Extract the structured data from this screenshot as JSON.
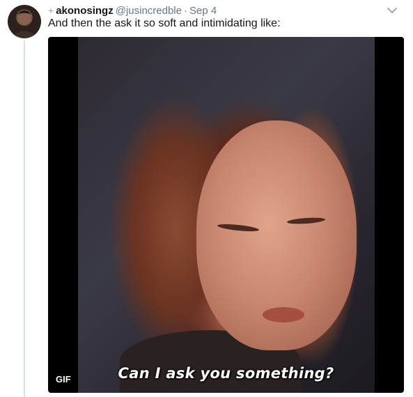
{
  "tweet": {
    "reply_marker": "+",
    "display_name": "akonosingz",
    "handle": "@jusincredble",
    "separator": "·",
    "date": "Sep 4",
    "text": "And then the ask it so soft and intimidating like:"
  },
  "media": {
    "type": "gif",
    "badge": "GIF",
    "caption": "Can I ask you something?"
  },
  "colors": {
    "name": "#14171a",
    "meta": "#657786",
    "thread_line": "#d6e3ec",
    "media_bg": "#000000"
  },
  "icons": {
    "menu": "chevron-down-icon"
  }
}
